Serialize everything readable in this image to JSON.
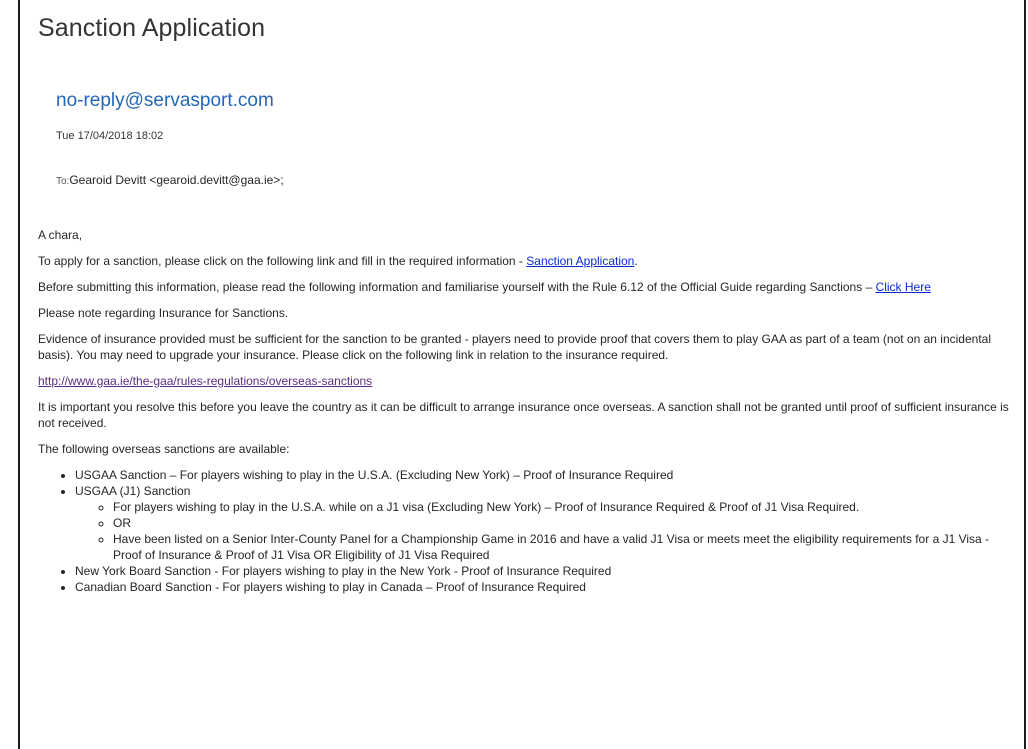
{
  "email": {
    "subject": "Sanction Application",
    "sender": "no-reply@servasport.com",
    "date": "Tue 17/04/2018 18:02",
    "to_label": "To:",
    "to_value": "Gearoid Devitt <gearoid.devitt@gaa.ie>;"
  },
  "body": {
    "greeting": "A chara,",
    "p1_text": "To apply for a sanction, please click on the following link and fill in the required information - ",
    "p1_link": "Sanction Application",
    "p1_end": ".",
    "p2_text": "Before submitting this information, please read the following information and familiarise yourself with the Rule 6.12 of the Official Guide regarding Sanctions – ",
    "p2_link": "Click Here",
    "p3": "Please note regarding Insurance for Sanctions.",
    "p4": "Evidence of insurance provided must be sufficient for the sanction to be granted - players need to provide proof that covers them to play GAA as part of a team (not on an incidental basis). You may need to upgrade your insurance. Please click on the following link in relation to the insurance required.",
    "url_link": "http://www.gaa.ie/the-gaa/rules-regulations/overseas-sanctions",
    "p5": "It is important you resolve this before you leave the country as it can be difficult to arrange insurance once overseas. A sanction shall not be granted until proof of sufficient insurance is not received.",
    "p6": "The following overseas sanctions are available:",
    "list": {
      "item1": "USGAA Sanction – For players wishing to play in the U.S.A. (Excluding New York) – Proof of Insurance Required",
      "item2": "USGAA (J1) Sanction",
      "item2_sub1": "For players wishing to play in the U.S.A. while on a J1 visa (Excluding New York) – Proof of Insurance Required & Proof of J1 Visa Required.",
      "item2_sub2": "OR",
      "item2_sub3": "Have been listed on a Senior Inter-County Panel for a Championship Game in 2016 and have a valid J1 Visa or meets meet the eligibility requirements for a J1 Visa - Proof of Insurance & Proof of J1 Visa OR Eligibility of J1 Visa Required",
      "item3": "New York Board Sanction - For players wishing to play in the New York - Proof of Insurance Required",
      "item4": "Canadian Board Sanction - For players wishing to play in Canada – Proof of Insurance Required"
    }
  },
  "colors": {
    "sender": "#2467b8",
    "link": "#0b2bd6",
    "visited_link": "#5b2c83"
  }
}
